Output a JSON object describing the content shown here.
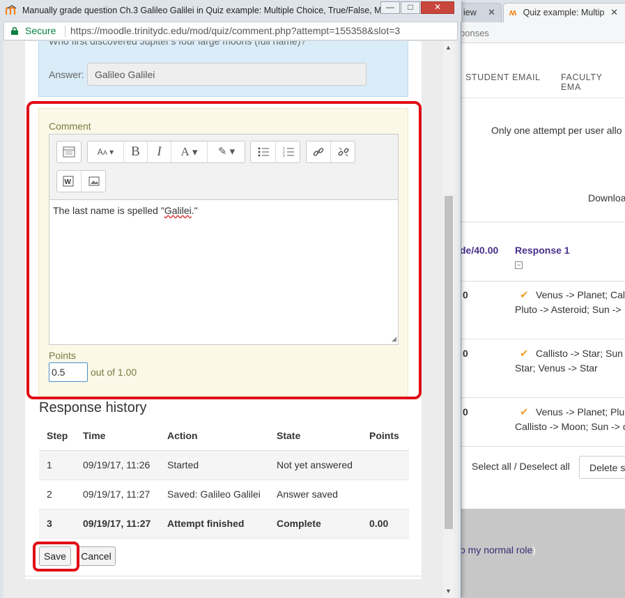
{
  "background_window": {
    "tab1_label": "iew",
    "tab2_label": "Quiz example: Multip",
    "breadcrumb": "ponses",
    "nav": [
      "STUDENT EMAIL",
      "FACULTY EMA"
    ],
    "attempt_note": "Only one attempt per user allo",
    "download_label": "Downloa",
    "grade_header": "de/40.00",
    "response_header": "Response 1",
    "rows": [
      {
        "grade": "0",
        "line1": "Venus -> Planet; Cal",
        "line2": "Pluto -> Asteroid; Sun ->"
      },
      {
        "grade": "0",
        "line1": "Callisto -> Star; Sun",
        "line2": "Star; Venus -> Star"
      },
      {
        "grade": "0",
        "line1": "Venus -> Planet; Plu",
        "line2": "Callisto -> Moon; Sun -> c"
      }
    ],
    "select_all": "Select all / Deselect all",
    "delete_btn": "Delete s",
    "footer_link": "o my normal role",
    "footer_paren": ")"
  },
  "popup": {
    "title": "Manually grade question Ch.3 Galileo Galilei in Quiz example: Multiple Choice, True/False, Matc...",
    "secure": "Secure",
    "url": "https://moodle.trinitydc.edu/mod/quiz/comment.php?attempt=155358&slot=3",
    "window_buttons": {
      "minimize": "—",
      "maximize": "□",
      "close": "✕"
    }
  },
  "question": {
    "text": "Who first discovered Jupiter's four large moons (full name)?",
    "answer_label": "Answer:",
    "answer_value": "Galileo Galilei"
  },
  "comment": {
    "label": "Comment",
    "text_prefix": "The last name is spelled \"",
    "text_word": "Galilei",
    "text_suffix": ".\""
  },
  "points": {
    "label": "Points",
    "value": "0.5",
    "max_text": "out of 1.00"
  },
  "history": {
    "title": "Response history",
    "headers": [
      "Step",
      "Time",
      "Action",
      "State",
      "Points"
    ],
    "rows": [
      {
        "step": "1",
        "time": "09/19/17, 11:26",
        "action": "Started",
        "state": "Not yet answered",
        "points": ""
      },
      {
        "step": "2",
        "time": "09/19/17, 11:27",
        "action": "Saved: Galileo Galilei",
        "state": "Answer saved",
        "points": ""
      },
      {
        "step": "3",
        "time": "09/19/17, 11:27",
        "action": "Attempt finished",
        "state": "Complete",
        "points": "0.00"
      }
    ]
  },
  "buttons": {
    "save": "Save",
    "cancel": "Cancel"
  },
  "colors": {
    "highlight": "#e00d16",
    "info_bg": "#d9ecf7",
    "comment_bg": "#fcf8e8",
    "secure": "#0b8043",
    "moodle": "#f98012"
  }
}
